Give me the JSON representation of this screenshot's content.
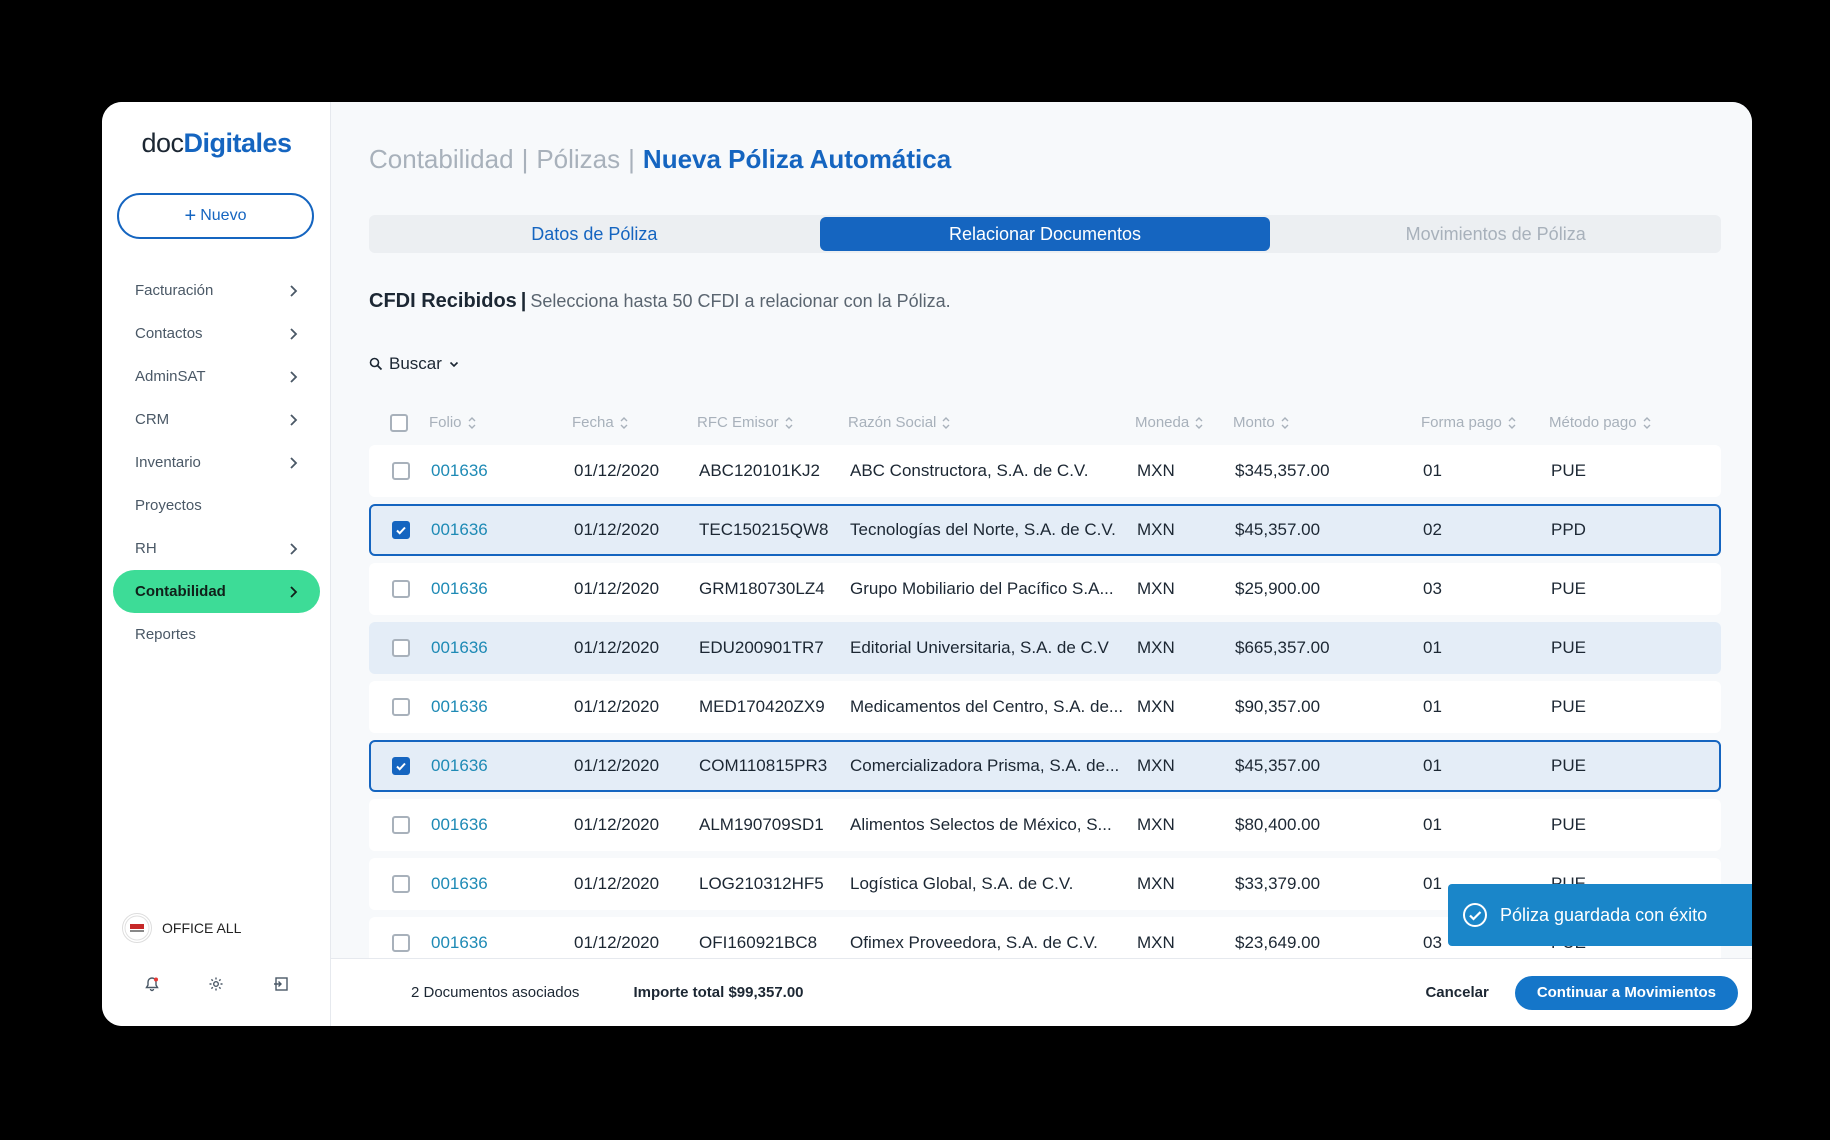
{
  "logo": {
    "part1": "doc",
    "part2": "Digitales"
  },
  "sidebar": {
    "new_button": "Nuevo",
    "items": [
      {
        "label": "Facturación",
        "has_chevron": true
      },
      {
        "label": "Contactos",
        "has_chevron": true
      },
      {
        "label": "AdminSAT",
        "has_chevron": true
      },
      {
        "label": "CRM",
        "has_chevron": true
      },
      {
        "label": "Inventario",
        "has_chevron": true
      },
      {
        "label": "Proyectos",
        "has_chevron": false
      },
      {
        "label": "RH",
        "has_chevron": true
      },
      {
        "label": "Contabilidad",
        "has_chevron": true,
        "active": true
      },
      {
        "label": "Reportes",
        "has_chevron": false
      }
    ],
    "company": "OFFICE ALL",
    "company_logo_text": "OFFICE ALL"
  },
  "breadcrumb": {
    "level1": "Contabilidad",
    "level2": "Pólizas",
    "current": "Nueva Póliza Automática"
  },
  "tabs": [
    "Datos de Póliza",
    "Relacionar Documentos",
    "Movimientos de Póliza"
  ],
  "active_tab": 1,
  "section": {
    "title": "CFDI Recibidos",
    "separator": "|",
    "description": "Selecciona hasta 50 CFDI a relacionar con la Póliza."
  },
  "search": {
    "label": "Buscar"
  },
  "table": {
    "headers": [
      "Folio",
      "Fecha",
      "RFC Emisor",
      "Razón Social",
      "Moneda",
      "Monto",
      "Forma pago",
      "Método pago"
    ],
    "rows": [
      {
        "folio": "001636",
        "fecha": "01/12/2020",
        "rfc": "ABC120101KJ2",
        "razon": "ABC Constructora, S.A. de C.V.",
        "moneda": "MXN",
        "monto": "$345,357.00",
        "forma": "01",
        "metodo": "PUE",
        "checked": false,
        "state": "normal"
      },
      {
        "folio": "001636",
        "fecha": "01/12/2020",
        "rfc": "TEC150215QW8",
        "razon": "Tecnologías del Norte, S.A. de C.V.",
        "moneda": "MXN",
        "monto": "$45,357.00",
        "forma": "02",
        "metodo": "PPD",
        "checked": true,
        "state": "selected"
      },
      {
        "folio": "001636",
        "fecha": "01/12/2020",
        "rfc": "GRM180730LZ4",
        "razon": "Grupo Mobiliario del Pacífico S.A...",
        "moneda": "MXN",
        "monto": "$25,900.00",
        "forma": "03",
        "metodo": "PUE",
        "checked": false,
        "state": "normal"
      },
      {
        "folio": "001636",
        "fecha": "01/12/2020",
        "rfc": "EDU200901TR7",
        "razon": "Editorial Universitaria, S.A. de C.V",
        "moneda": "MXN",
        "monto": "$665,357.00",
        "forma": "01",
        "metodo": "PUE",
        "checked": false,
        "state": "hover"
      },
      {
        "folio": "001636",
        "fecha": "01/12/2020",
        "rfc": "MED170420ZX9",
        "razon": "Medicamentos del Centro, S.A. de...",
        "moneda": "MXN",
        "monto": "$90,357.00",
        "forma": "01",
        "metodo": "PUE",
        "checked": false,
        "state": "normal"
      },
      {
        "folio": "001636",
        "fecha": "01/12/2020",
        "rfc": "COM110815PR3",
        "razon": "Comercializadora Prisma, S.A. de...",
        "moneda": "MXN",
        "monto": "$45,357.00",
        "forma": "01",
        "metodo": "PUE",
        "checked": true,
        "state": "selected"
      },
      {
        "folio": "001636",
        "fecha": "01/12/2020",
        "rfc": "ALM190709SD1",
        "razon": "Alimentos Selectos de México, S...",
        "moneda": "MXN",
        "monto": "$80,400.00",
        "forma": "01",
        "metodo": "PUE",
        "checked": false,
        "state": "normal"
      },
      {
        "folio": "001636",
        "fecha": "01/12/2020",
        "rfc": "LOG210312HF5",
        "razon": "Logística Global, S.A. de C.V.",
        "moneda": "MXN",
        "monto": "$33,379.00",
        "forma": "01",
        "metodo": "PUE",
        "checked": false,
        "state": "normal"
      },
      {
        "folio": "001636",
        "fecha": "01/12/2020",
        "rfc": "OFI160921BC8",
        "razon": "Ofimex Proveedora, S.A. de C.V.",
        "moneda": "MXN",
        "monto": "$23,649.00",
        "forma": "03",
        "metodo": "PUE",
        "checked": false,
        "state": "normal"
      }
    ]
  },
  "footer": {
    "documents": "2 Documentos asociados",
    "total": "Importe total $99,357.00",
    "cancel": "Cancelar",
    "continue": "Continuar a Movimientos"
  },
  "toast": {
    "message": "Póliza guardada con éxito"
  },
  "colors": {
    "primary": "#1565c0",
    "active_nav": "#3ddc97",
    "link": "#1e8ab5",
    "toast": "#1a86c9",
    "selected_row": "#e4edf7"
  }
}
